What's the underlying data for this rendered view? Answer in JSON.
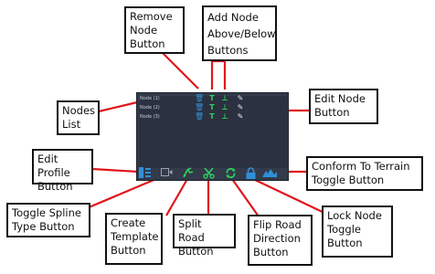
{
  "labels": {
    "remove_node": "Remove\nNode\nButton",
    "add_node": "Add Node\nAbove/Below\nButtons",
    "nodes_list": "Nodes\nList",
    "edit_node": "Edit Node\nButton",
    "edit_profile": "Edit Profile\nButton",
    "conform_terrain": "Conform To Terrain\nToggle Button",
    "toggle_spline": "Toggle Spline\nType Button",
    "create_template": "Create\nTemplate\nButton",
    "split_road": "Split Road\nButton",
    "flip_road": "Flip Road\nDirection\nButton",
    "lock_node": "Lock Node\nToggle\nButton"
  },
  "panel": {
    "nodes": [
      {
        "name": "Node (1)"
      },
      {
        "name": "Node (2)"
      },
      {
        "name": "Node (3)"
      }
    ]
  },
  "colors": {
    "arrow": "#e0161b",
    "panel_bg": "#333a4a",
    "list_bg": "#2b3140",
    "icon_blue": "#2f8fd8",
    "icon_green": "#2fcf5f"
  }
}
